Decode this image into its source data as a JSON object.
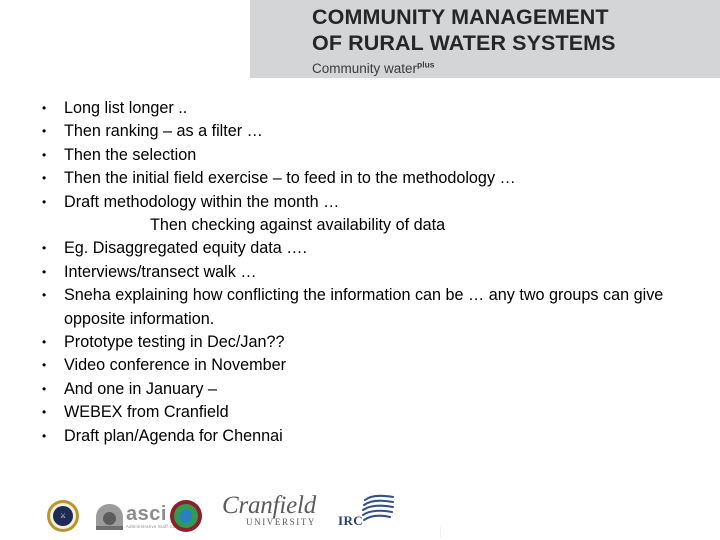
{
  "slide": {
    "header": {
      "title_line1": "COMMUNITY MANAGEMENT",
      "title_line2": "OF RURAL WATER SYSTEMS",
      "subtitle_main": "Community water",
      "subtitle_sup": "plus",
      "band_color": "#d4d5d7",
      "text_color": "#262626"
    },
    "body": {
      "bullet_glyph": "•",
      "items": [
        {
          "type": "bullet",
          "text": "Long list longer .."
        },
        {
          "type": "bullet",
          "text": "Then ranking – as a filter …"
        },
        {
          "type": "bullet",
          "text": "Then the selection"
        },
        {
          "type": "bullet",
          "text": "Then the initial field exercise – to feed in to the methodology …"
        },
        {
          "type": "bullet",
          "text": "Draft methodology within the month …"
        },
        {
          "type": "plain",
          "text": "Then checking against availability of data"
        },
        {
          "type": "bullet",
          "text": "Eg. Disaggregated equity data …."
        },
        {
          "type": "bullet",
          "text": "Interviews/transect walk …"
        },
        {
          "type": "bullet",
          "text": "Sneha explaining how conflicting the information can be … any two groups can give opposite information."
        },
        {
          "type": "bullet",
          "text": "Prototype testing  in Dec/Jan??"
        },
        {
          "type": "bullet",
          "text": "Video conference in November"
        },
        {
          "type": "bullet",
          "text": "And one in January –"
        },
        {
          "type": "bullet",
          "text": "WEBEX from Cranfield"
        },
        {
          "type": "bullet",
          "text": "Draft plan/Agenda for Chennai"
        }
      ]
    },
    "logos": [
      {
        "name": "seal-logo",
        "label": ""
      },
      {
        "name": "asci-logo",
        "label": "asci",
        "tagline": "Administrative Staff College"
      },
      {
        "name": "globe-water-logo",
        "label": ""
      },
      {
        "name": "cranfield-logo",
        "label": "Cranfield",
        "sub": "UNIVERSITY"
      },
      {
        "name": "irc-logo",
        "label": "IRC"
      }
    ]
  }
}
